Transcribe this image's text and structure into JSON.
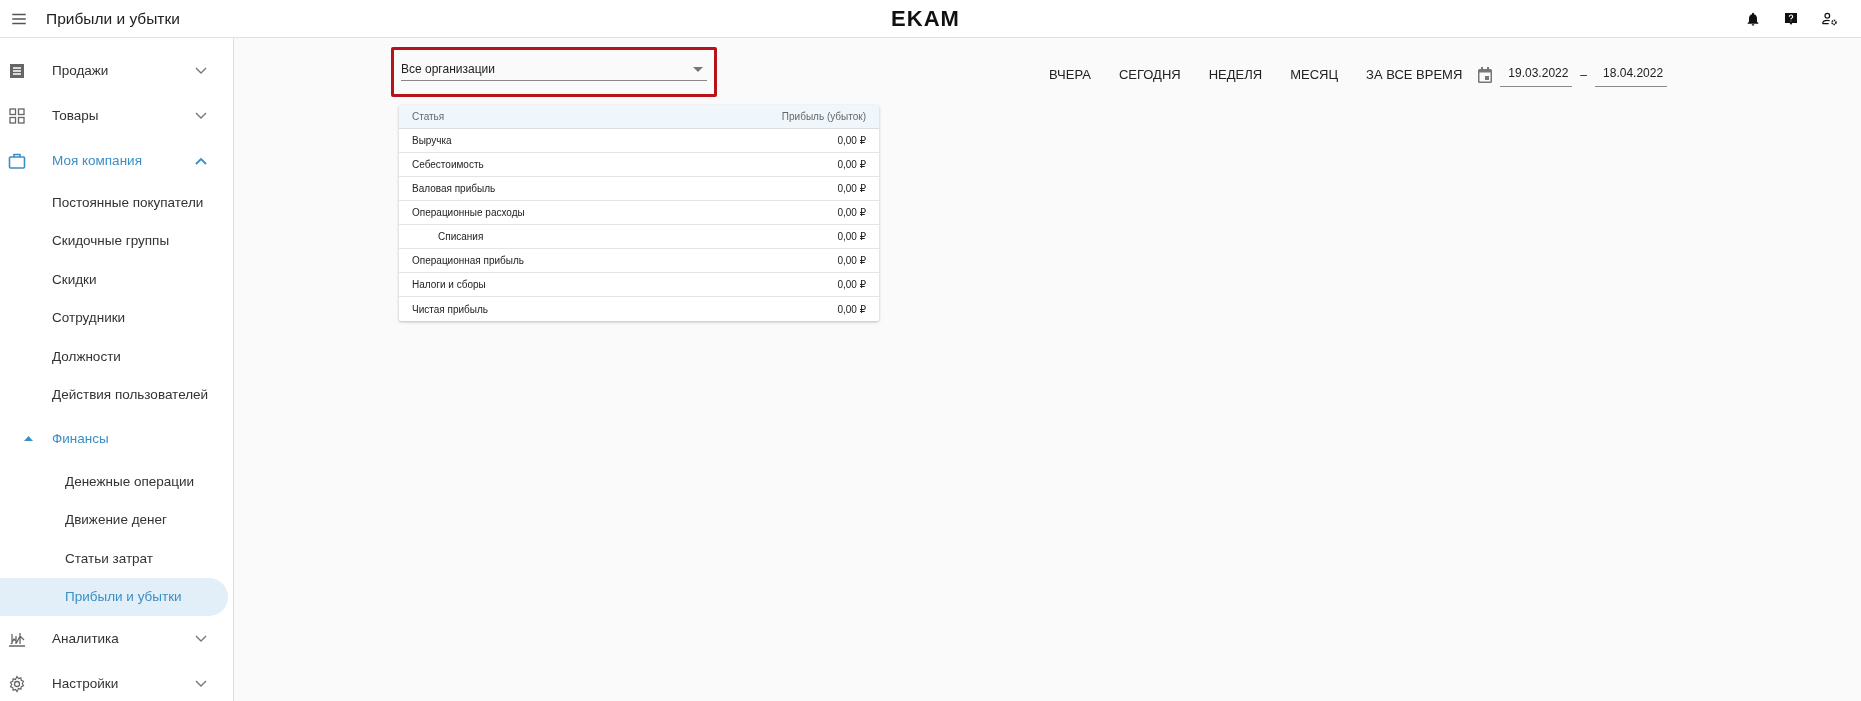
{
  "app_bar": {
    "title": "Прибыли и убытки",
    "logo": "EKAM"
  },
  "sidebar": {
    "items": [
      {
        "label": "Продажи",
        "expanded": false,
        "selected": false
      },
      {
        "label": "Товары",
        "expanded": false,
        "selected": false
      },
      {
        "label": "Моя компания",
        "expanded": true,
        "selected": false,
        "children": [
          {
            "label": "Постоянные покупатели",
            "selected": false
          },
          {
            "label": "Скидочные группы",
            "selected": false
          },
          {
            "label": "Скидки",
            "selected": false
          },
          {
            "label": "Сотрудники",
            "selected": false
          },
          {
            "label": "Должности",
            "selected": false
          },
          {
            "label": "Действия пользователей",
            "selected": false
          },
          {
            "label": "Финансы",
            "expanded": true,
            "selected": false,
            "children": [
              {
                "label": "Денежные операции",
                "selected": false
              },
              {
                "label": "Движение денег",
                "selected": false
              },
              {
                "label": "Статьи затрат",
                "selected": false
              },
              {
                "label": "Прибыли и убытки",
                "selected": true
              }
            ]
          }
        ]
      },
      {
        "label": "Аналитика",
        "expanded": false,
        "selected": false
      },
      {
        "label": "Настройки",
        "expanded": false,
        "selected": false
      }
    ]
  },
  "filter": {
    "value": "Все организации",
    "highlighted": true
  },
  "periods": [
    {
      "label": "ВЧЕРА",
      "selected": false
    },
    {
      "label": "СЕГОДНЯ",
      "selected": false
    },
    {
      "label": "НЕДЕЛЯ",
      "selected": false
    },
    {
      "label": "МЕСЯЦ",
      "selected": false
    },
    {
      "label": "ЗА ВСЕ ВРЕМЯ",
      "selected": false
    }
  ],
  "date_range": {
    "from": "19.03.2022",
    "separator": "–",
    "to": "18.04.2022"
  },
  "table": {
    "columns": [
      "Статья",
      "Прибыль (убыток)"
    ],
    "rows": [
      {
        "item": "Выручка",
        "amount": "0,00 ₽"
      },
      {
        "item": "Себестоимость",
        "amount": "0,00 ₽"
      },
      {
        "item": "Валовая прибыль",
        "amount": "0,00 ₽"
      },
      {
        "item": "Операционные расходы",
        "amount": "0,00 ₽",
        "children": [
          {
            "item": "Списания",
            "amount": "0,00 ₽"
          }
        ]
      },
      {
        "item": "Операционная прибыль",
        "amount": "0,00 ₽"
      },
      {
        "item": "Налоги и сборы",
        "amount": "0,00 ₽"
      },
      {
        "item": "Чистая прибыль",
        "amount": "0,00 ₽"
      }
    ]
  }
}
